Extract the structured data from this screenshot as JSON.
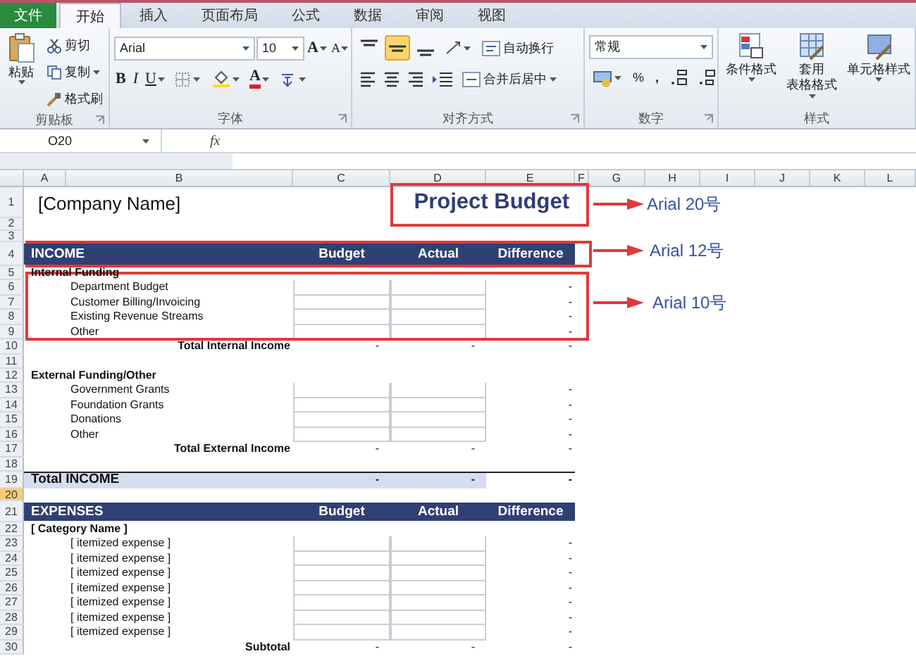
{
  "tabs": [
    {
      "label": "文件",
      "kind": "file",
      "selected": false
    },
    {
      "label": "开始",
      "kind": "tab",
      "selected": true
    },
    {
      "label": "插入",
      "kind": "tab",
      "selected": false
    },
    {
      "label": "页面布局",
      "kind": "tab",
      "selected": false
    },
    {
      "label": "公式",
      "kind": "tab",
      "selected": false
    },
    {
      "label": "数据",
      "kind": "tab",
      "selected": false
    },
    {
      "label": "审阅",
      "kind": "tab",
      "selected": false
    },
    {
      "label": "视图",
      "kind": "tab",
      "selected": false
    }
  ],
  "ribbon": {
    "clipboard": {
      "label": "剪贴板",
      "paste": "粘贴",
      "cut": "剪切",
      "copy": "复制",
      "painter": "格式刷"
    },
    "font": {
      "label": "字体",
      "name": "Arial",
      "size": "10",
      "grow": "A",
      "shrink": "A",
      "bold": "B",
      "italic": "I",
      "underline": "U",
      "font_color_label": "A"
    },
    "alignment": {
      "label": "对齐方式",
      "vertical": [
        {
          "kind": "top",
          "selected": false
        },
        {
          "kind": "middle",
          "selected": true
        },
        {
          "kind": "bottom",
          "selected": false
        }
      ],
      "wrap": "自动换行",
      "merge": "合并后居中"
    },
    "number": {
      "label": "数字",
      "format": "常规",
      "percent": "%",
      "comma": ","
    },
    "styles": {
      "label": "样式",
      "buttons": [
        {
          "kind": "conditional",
          "lines": [
            "条件格式"
          ]
        },
        {
          "kind": "table",
          "lines": [
            "套用",
            "表格格式"
          ]
        },
        {
          "kind": "cell",
          "lines": [
            "单元格样式"
          ]
        }
      ]
    }
  },
  "formula_bar": {
    "name_box": "O20",
    "fx": "fx"
  },
  "sheet": {
    "columns": [
      "A",
      "B",
      "C",
      "D",
      "E",
      "F",
      "G",
      "H",
      "I",
      "J",
      "K",
      "L"
    ],
    "rows": [
      {
        "num": "1",
        "kind": "company",
        "selected": false,
        "company": "[Company Name]",
        "title": "Project Budget"
      },
      {
        "num": "2",
        "kind": "blank",
        "selected": false
      },
      {
        "num": "3",
        "kind": "blank",
        "selected": false
      },
      {
        "num": "4",
        "kind": "section",
        "selected": false,
        "label": "INCOME",
        "columns": [
          "Budget",
          "Actual",
          "Difference"
        ]
      },
      {
        "num": "5",
        "kind": "group",
        "selected": false,
        "label": "Internal Funding"
      },
      {
        "num": "6",
        "kind": "item",
        "selected": false,
        "label": "Department Budget",
        "difference": "-"
      },
      {
        "num": "7",
        "kind": "item",
        "selected": false,
        "label": "Customer Billing/Invoicing",
        "difference": "-"
      },
      {
        "num": "8",
        "kind": "item",
        "selected": false,
        "label": "Existing Revenue Streams",
        "difference": "-"
      },
      {
        "num": "9",
        "kind": "item",
        "selected": false,
        "label": "Other",
        "difference": "-"
      },
      {
        "num": "10",
        "kind": "total",
        "selected": false,
        "label": "Total Internal Income",
        "values": [
          "-",
          "-",
          "-"
        ]
      },
      {
        "num": "11",
        "kind": "blank",
        "selected": false
      },
      {
        "num": "12",
        "kind": "group",
        "selected": false,
        "label": "External Funding/Other"
      },
      {
        "num": "13",
        "kind": "item",
        "selected": false,
        "label": "Government Grants",
        "difference": "-"
      },
      {
        "num": "14",
        "kind": "item",
        "selected": false,
        "label": "Foundation Grants",
        "difference": "-"
      },
      {
        "num": "15",
        "kind": "item",
        "selected": false,
        "label": "Donations",
        "difference": "-"
      },
      {
        "num": "16",
        "kind": "item",
        "selected": false,
        "label": "Other",
        "difference": "-"
      },
      {
        "num": "17",
        "kind": "total",
        "selected": false,
        "label": "Total External Income",
        "values": [
          "-",
          "-",
          "-"
        ]
      },
      {
        "num": "18",
        "kind": "blank",
        "selected": false
      },
      {
        "num": "19",
        "kind": "grand_total",
        "selected": false,
        "label": "Total INCOME",
        "values": [
          "-",
          "-",
          "-"
        ]
      },
      {
        "num": "20",
        "kind": "blank",
        "selected": true
      },
      {
        "num": "21",
        "kind": "section",
        "selected": false,
        "label": "EXPENSES",
        "columns": [
          "Budget",
          "Actual",
          "Difference"
        ]
      },
      {
        "num": "22",
        "kind": "group",
        "selected": false,
        "label": "[ Category Name ]"
      },
      {
        "num": "23",
        "kind": "item",
        "selected": false,
        "label": "[ itemized expense ]",
        "difference": "-"
      },
      {
        "num": "24",
        "kind": "item",
        "selected": false,
        "label": "[ itemized expense ]",
        "difference": "-"
      },
      {
        "num": "25",
        "kind": "item",
        "selected": false,
        "label": "[ itemized expense ]",
        "difference": "-"
      },
      {
        "num": "26",
        "kind": "item",
        "selected": false,
        "label": "[ itemized expense ]",
        "difference": "-"
      },
      {
        "num": "27",
        "kind": "item",
        "selected": false,
        "label": "[ itemized expense ]",
        "difference": "-"
      },
      {
        "num": "28",
        "kind": "item",
        "selected": false,
        "label": "[ itemized expense ]",
        "difference": "-"
      },
      {
        "num": "29",
        "kind": "item",
        "selected": false,
        "label": "[ itemized expense ]",
        "difference": "-"
      },
      {
        "num": "30",
        "kind": "total",
        "selected": false,
        "label": "Subtotal",
        "values": [
          "-",
          "-",
          "-"
        ]
      }
    ]
  },
  "annotations": [
    {
      "label": "Arial 20号"
    },
    {
      "label": "Arial 12号"
    },
    {
      "label": "Arial 10号"
    }
  ]
}
